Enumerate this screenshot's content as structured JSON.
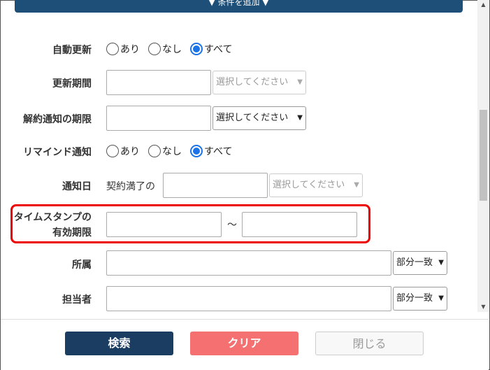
{
  "add_condition_label": "▼ 条件を追加 ▼",
  "fields": {
    "auto_renewal": {
      "label": "自動更新",
      "options": [
        "あり",
        "なし",
        "すべて"
      ],
      "selected": "すべて"
    },
    "renewal_period": {
      "label": "更新期間",
      "value": "",
      "select_text": "選択してください"
    },
    "cancel_notice": {
      "label": "解約通知の期限",
      "value": "",
      "select_text": "選択してください"
    },
    "remind_notice": {
      "label": "リマインド通知",
      "options": [
        "あり",
        "なし",
        "すべて"
      ],
      "selected": "すべて"
    },
    "notice_date": {
      "label": "通知日",
      "prefix": "契約満了の",
      "value": "",
      "select_text": "選択してください"
    },
    "timestamp": {
      "label_line1": "タイムスタンプの",
      "label_line2": "有効期限",
      "from": "",
      "to": "",
      "separator": "～"
    },
    "department": {
      "label": "所属",
      "value": "",
      "match": "部分一致"
    },
    "owner": {
      "label": "担当者",
      "value": "",
      "match": "部分一致"
    }
  },
  "buttons": {
    "search": "検索",
    "clear": "クリア",
    "close": "閉じる"
  },
  "colors": {
    "primary": "#1b3d62",
    "clear": "#f57070",
    "highlight": "#e00000",
    "radio_selected": "#1a73e8"
  }
}
